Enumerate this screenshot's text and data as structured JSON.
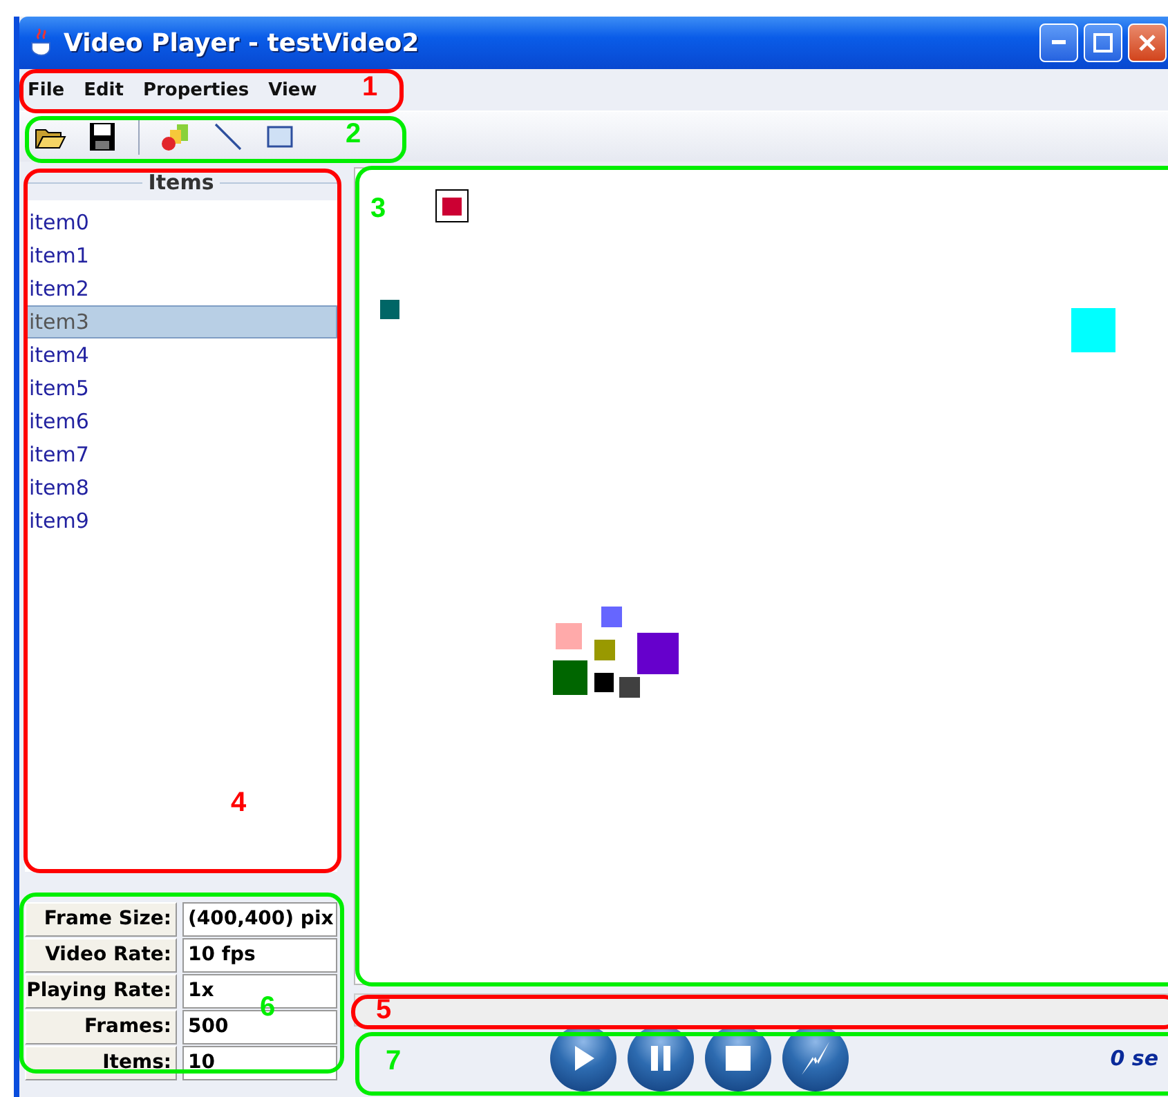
{
  "window": {
    "title": "Video Player - testVideo2"
  },
  "menu": [
    "File",
    "Edit",
    "Properties",
    "View"
  ],
  "toolbar": [
    {
      "kind": "open"
    },
    {
      "kind": "save"
    },
    {
      "kind": "separator"
    },
    {
      "kind": "blocks"
    },
    {
      "kind": "line"
    },
    {
      "kind": "rectangle"
    }
  ],
  "items_panel": {
    "title": "Items",
    "items": [
      {
        "label": "item0",
        "selected": false
      },
      {
        "label": "item1",
        "selected": false
      },
      {
        "label": "item2",
        "selected": false
      },
      {
        "label": "item3",
        "selected": true
      },
      {
        "label": "item4",
        "selected": false
      },
      {
        "label": "item5",
        "selected": false
      },
      {
        "label": "item6",
        "selected": false
      },
      {
        "label": "item7",
        "selected": false
      },
      {
        "label": "item8",
        "selected": false
      },
      {
        "label": "item9",
        "selected": false
      }
    ]
  },
  "info": [
    {
      "label": "Frame Size:",
      "value": "(400,400) pix"
    },
    {
      "label": "Video Rate:",
      "value": "10 fps"
    },
    {
      "label": "Playing Rate:",
      "value": "1x"
    },
    {
      "label": "Frames:",
      "value": "500"
    },
    {
      "label": "Items:",
      "value": "10"
    }
  ],
  "canvas": {
    "shapes": [
      {
        "color": "#cc0033",
        "selected": true
      },
      {
        "color": "#006666",
        "selected": false
      },
      {
        "color": "#00ffff",
        "selected": false
      },
      {
        "color": "#ffaaaa",
        "selected": false
      },
      {
        "color": "#6666ff",
        "selected": false
      },
      {
        "color": "#999900",
        "selected": false
      },
      {
        "color": "#6600cc",
        "selected": false
      },
      {
        "color": "#006600",
        "selected": false
      },
      {
        "color": "#000000",
        "selected": false
      },
      {
        "color": "#404040",
        "selected": false
      }
    ]
  },
  "controls": [
    {
      "kind": "play"
    },
    {
      "kind": "pause"
    },
    {
      "kind": "stop"
    },
    {
      "kind": "flash"
    }
  ],
  "time": "0 se",
  "annotations": [
    {
      "label": "1",
      "color": "#ff0000"
    },
    {
      "label": "2",
      "color": "#00ee00"
    },
    {
      "label": "3",
      "color": "#00ee00"
    },
    {
      "label": "4",
      "color": "#ff0000"
    },
    {
      "label": "5",
      "color": "#ff0000"
    },
    {
      "label": "6",
      "color": "#00ee00"
    },
    {
      "label": "7",
      "color": "#00ee00"
    }
  ]
}
